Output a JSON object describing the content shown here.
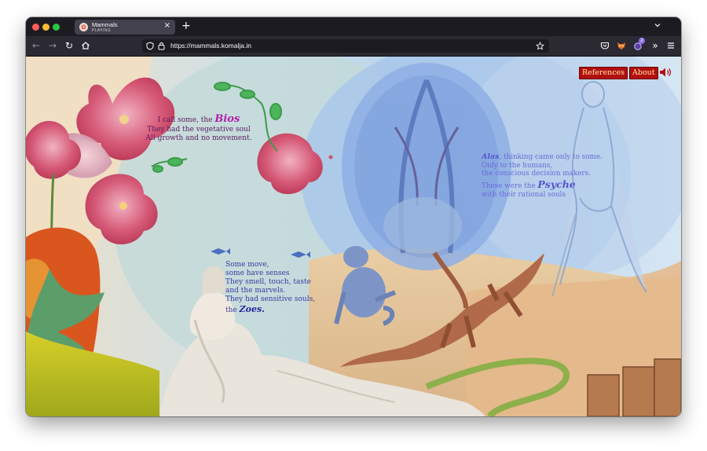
{
  "browser": {
    "tab": {
      "title": "Mammals",
      "subtitle": "PLAYING",
      "close": "×"
    },
    "new_tab": "+",
    "url": "https://mammals.komalja.in"
  },
  "site": {
    "nav": {
      "references": "References",
      "about": "About"
    },
    "poems": {
      "bios": {
        "l1_pre": "I call some, the ",
        "l1_word": "Bios",
        "l2": "They had the vegetative soul",
        "l3": "All growth and no movement."
      },
      "zoes": {
        "l1": "Some move,",
        "l2": "some have senses",
        "l3": "They smell, touch, taste",
        "l4": "and the marvels.",
        "l5": "They had sensitive souls,",
        "l6_pre": "the ",
        "l6_word": "Zoes."
      },
      "psyche": {
        "l1_word": "Alas",
        "l1_post": ", thinking came only to some.",
        "l2": "Only to the humans,",
        "l3": "the conscious decision makers.",
        "l4_pre": "These were the ",
        "l4_word": "Psyche",
        "l5": "with their rational souls"
      }
    }
  },
  "colors": {
    "button_bg": "#b20f0f",
    "button_text": "#ffe9a8",
    "tab_bg": "#42414d",
    "toolbar_bg": "#2b2a33"
  },
  "icons": [
    "back-arrow-icon",
    "forward-arrow-icon",
    "reload-icon",
    "home-icon",
    "shield-icon",
    "lock-icon",
    "star-icon",
    "pocket-icon",
    "fox-extension-icon",
    "extension-icon",
    "overflow-chevron-icon",
    "menu-icon",
    "speaker-icon"
  ]
}
